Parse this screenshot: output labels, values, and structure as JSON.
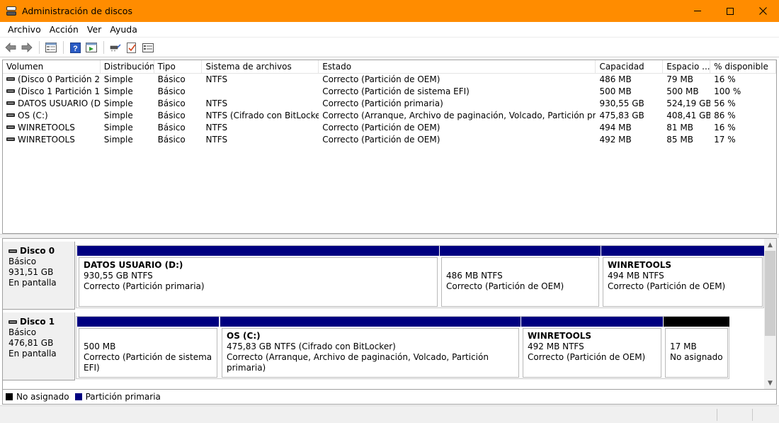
{
  "window": {
    "title": "Administración de discos",
    "accent": "#ff8c00"
  },
  "menu": [
    "Archivo",
    "Acción",
    "Ver",
    "Ayuda"
  ],
  "toolbar": [
    "back-icon",
    "forward-icon",
    "disk-list-icon",
    "help-icon",
    "properties-icon",
    "rescan-icon",
    "check-icon",
    "settings-icon"
  ],
  "volume_list": {
    "headers": [
      "Volumen",
      "Distribución",
      "Tipo",
      "Sistema de archivos",
      "Estado",
      "Capacidad",
      "Espacio ...",
      "% disponible"
    ],
    "rows": [
      [
        "(Disco 0 Partición 2)",
        "Simple",
        "Básico",
        "NTFS",
        "Correcto (Partición de OEM)",
        "486 MB",
        "79 MB",
        "16 %"
      ],
      [
        "(Disco 1 Partición 1)",
        "Simple",
        "Básico",
        "",
        "Correcto (Partición de sistema EFI)",
        "500 MB",
        "500 MB",
        "100 %"
      ],
      [
        "DATOS USUARIO (D:)",
        "Simple",
        "Básico",
        "NTFS",
        "Correcto (Partición primaria)",
        "930,55 GB",
        "524,19 GB",
        "56 %"
      ],
      [
        "OS (C:)",
        "Simple",
        "Básico",
        "NTFS (Cifrado con BitLocker)",
        "Correcto (Arranque, Archivo de paginación, Volcado, Partición primaria)",
        "475,83 GB",
        "408,41 GB",
        "86 %"
      ],
      [
        "WINRETOOLS",
        "Simple",
        "Básico",
        "NTFS",
        "Correcto (Partición de OEM)",
        "494 MB",
        "81 MB",
        "16 %"
      ],
      [
        "WINRETOOLS",
        "Simple",
        "Básico",
        "NTFS",
        "Correcto (Partición de OEM)",
        "492 MB",
        "85 MB",
        "17 %"
      ]
    ]
  },
  "disks": [
    {
      "name": "Disco 0",
      "type": "Básico",
      "size": "931,51 GB",
      "status": "En pantalla",
      "partitions": [
        {
          "name": "DATOS USUARIO  (D:)",
          "size": "930,55 GB NTFS",
          "status": "Correcto (Partición primaria)"
        },
        {
          "name": "",
          "size": "486 MB NTFS",
          "status": "Correcto (Partición de OEM)"
        },
        {
          "name": "WINRETOOLS",
          "size": "494 MB NTFS",
          "status": "Correcto (Partición de OEM)"
        }
      ]
    },
    {
      "name": "Disco 1",
      "type": "Básico",
      "size": "476,81 GB",
      "status": "En pantalla",
      "partitions": [
        {
          "name": "",
          "size": "500 MB",
          "status": "Correcto (Partición de sistema EFI)"
        },
        {
          "name": "OS  (C:)",
          "size": "475,83 GB NTFS (Cifrado con BitLocker)",
          "status": "Correcto (Arranque, Archivo de paginación, Volcado, Partición primaria)"
        },
        {
          "name": "WINRETOOLS",
          "size": "492 MB NTFS",
          "status": "Correcto (Partición de OEM)"
        },
        {
          "name": "",
          "size": "17 MB",
          "status": "No asignado"
        }
      ]
    }
  ],
  "legend": [
    {
      "label": "No asignado",
      "color": "#000000"
    },
    {
      "label": "Partición primaria",
      "color": "#000080"
    }
  ]
}
